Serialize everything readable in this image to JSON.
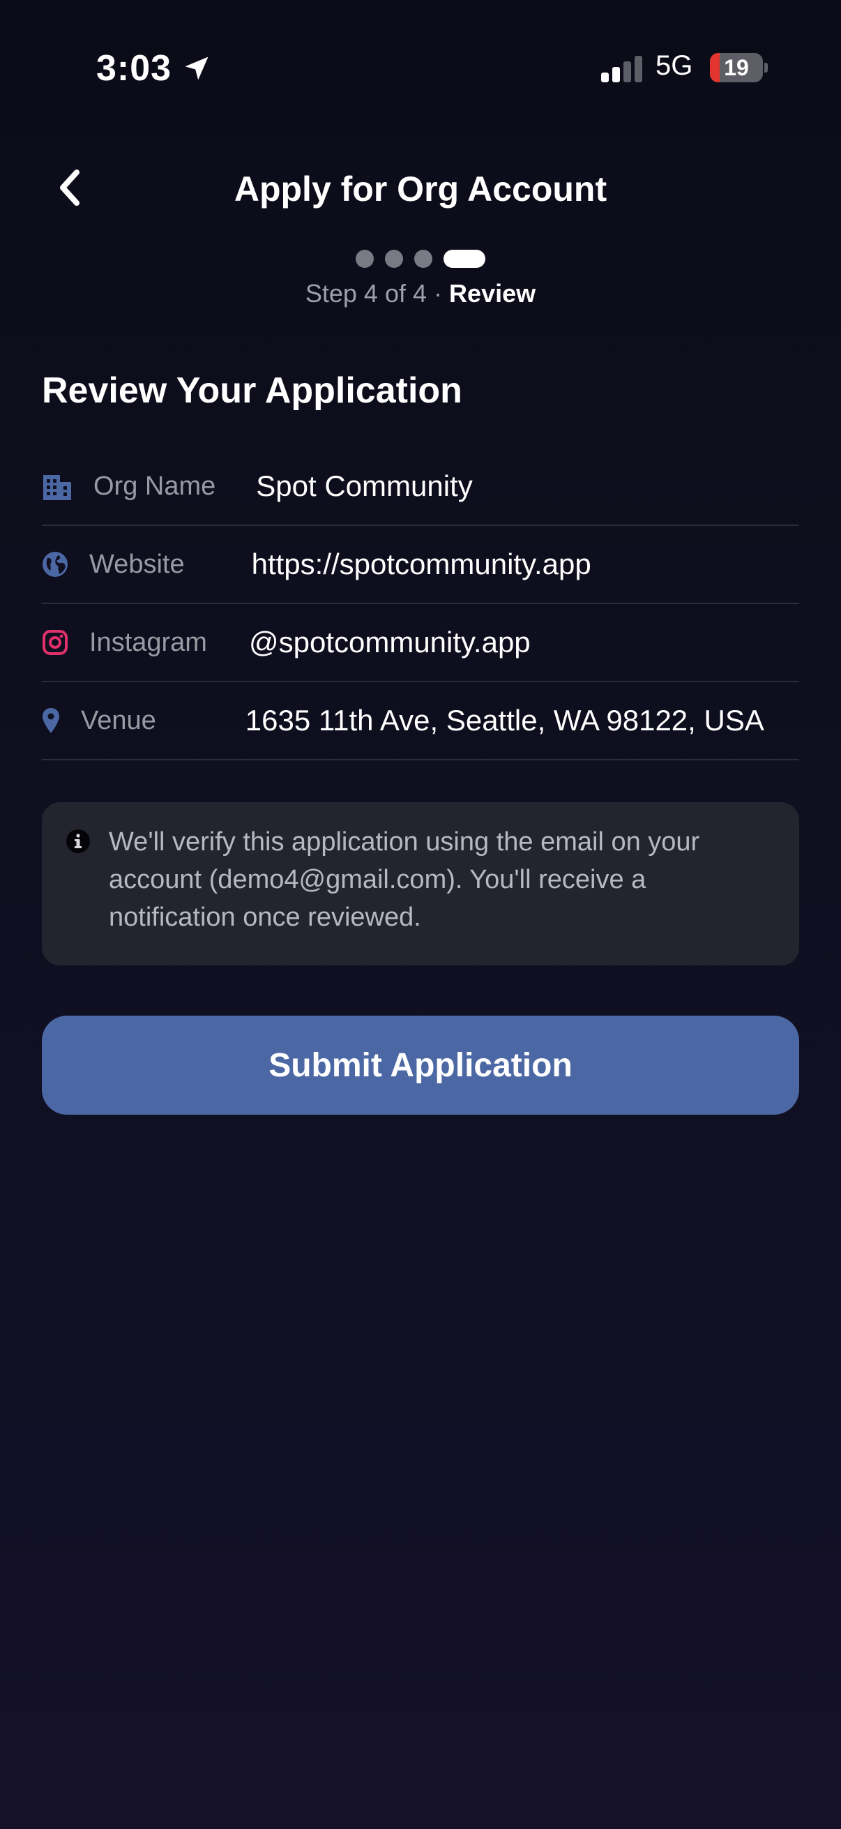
{
  "status_bar": {
    "time": "3:03",
    "network": "5G",
    "battery_level": "19",
    "battery_fraction": 0.19
  },
  "header": {
    "title": "Apply for Org Account",
    "back_icon": "chevron-left-icon"
  },
  "steps": {
    "total": 4,
    "current": 4,
    "count_label": "Step 4 of 4",
    "separator": "·",
    "name_label": "Review"
  },
  "section": {
    "heading": "Review Your Application"
  },
  "review": {
    "rows": [
      {
        "icon": "building-icon",
        "label": "Org Name",
        "value": "Spot Community",
        "icon_color": "#4c68a4"
      },
      {
        "icon": "globe-icon",
        "label": "Website",
        "value": "https://spotcommunity.app",
        "icon_color": "#4c68a4"
      },
      {
        "icon": "instagram-icon",
        "label": "Instagram",
        "value": "@spotcommunity.app",
        "icon_color": "#e1306c"
      },
      {
        "icon": "map-pin-icon",
        "label": "Venue",
        "value": "1635 11th Ave, Seattle, WA 98122, USA",
        "icon_color": "#4c68a4"
      }
    ]
  },
  "info_note": {
    "icon": "info-icon",
    "text": "We'll verify this application using the email on your account (demo4@gmail.com). You'll receive a notification once reviewed."
  },
  "actions": {
    "submit_label": "Submit Application"
  },
  "colors": {
    "background": "#0f0f20",
    "accent": "#4c68a4",
    "instagram": "#e1306c",
    "battery_low": "#e3342f",
    "card": "#24242f"
  }
}
